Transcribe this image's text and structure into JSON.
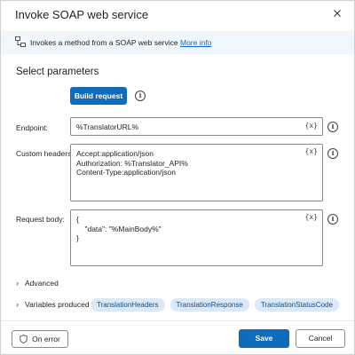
{
  "dialog": {
    "title": "Invoke SOAP web service"
  },
  "info_bar": {
    "text": "Invokes a method from a SOAP web service",
    "link": "More info"
  },
  "section": {
    "title": "Select parameters"
  },
  "build_request": {
    "label": "Build request"
  },
  "fields": {
    "endpoint": {
      "label": "Endpoint:",
      "value": "%TranslatorURL%"
    },
    "custom_headers": {
      "label": "Custom headers:",
      "value": "Accept:application/json\nAuthorization: %Translator_API%\nContent-Type:application/json"
    },
    "request_body": {
      "label": "Request body:",
      "value": "{\n    \"data\": \"%MainBody%\"\n}"
    },
    "var_badge": "{x}"
  },
  "advanced": {
    "label": "Advanced"
  },
  "variables": {
    "label": "Variables produced",
    "chips": [
      "TranslationHeaders",
      "TranslationResponse",
      "TranslationStatusCode"
    ]
  },
  "footer": {
    "on_error": "On error",
    "save": "Save",
    "cancel": "Cancel"
  },
  "colors": {
    "accent": "#0f6cbd",
    "info_bg": "#eff6fc",
    "chip_bg": "#dbe9f7"
  },
  "icons": {
    "close": "close-icon",
    "info": "soap-service-icon",
    "help": "info-circle-icon",
    "chevron": "chevron-right-icon",
    "shield": "shield-icon"
  }
}
